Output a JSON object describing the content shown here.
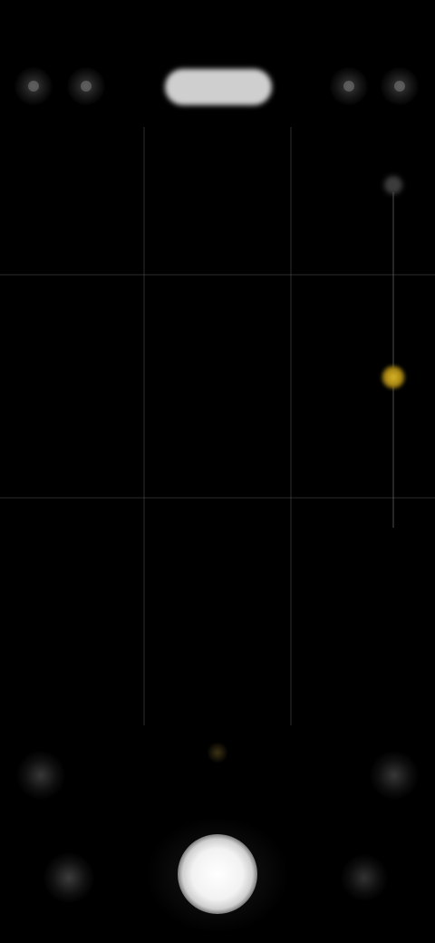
{
  "status_bar": {
    "time": ""
  },
  "top_toolbar": {
    "mode_label": "",
    "icons": [
      "flash-icon",
      "timer-icon",
      "settings-icon",
      "more-icon"
    ]
  },
  "viewfinder": {
    "grid": "on",
    "exposure_level": 0.55
  },
  "colors": {
    "background": "#000000",
    "accent": "#d9b52a",
    "shutter": "#ffffff",
    "control": "#6e6e6e"
  }
}
